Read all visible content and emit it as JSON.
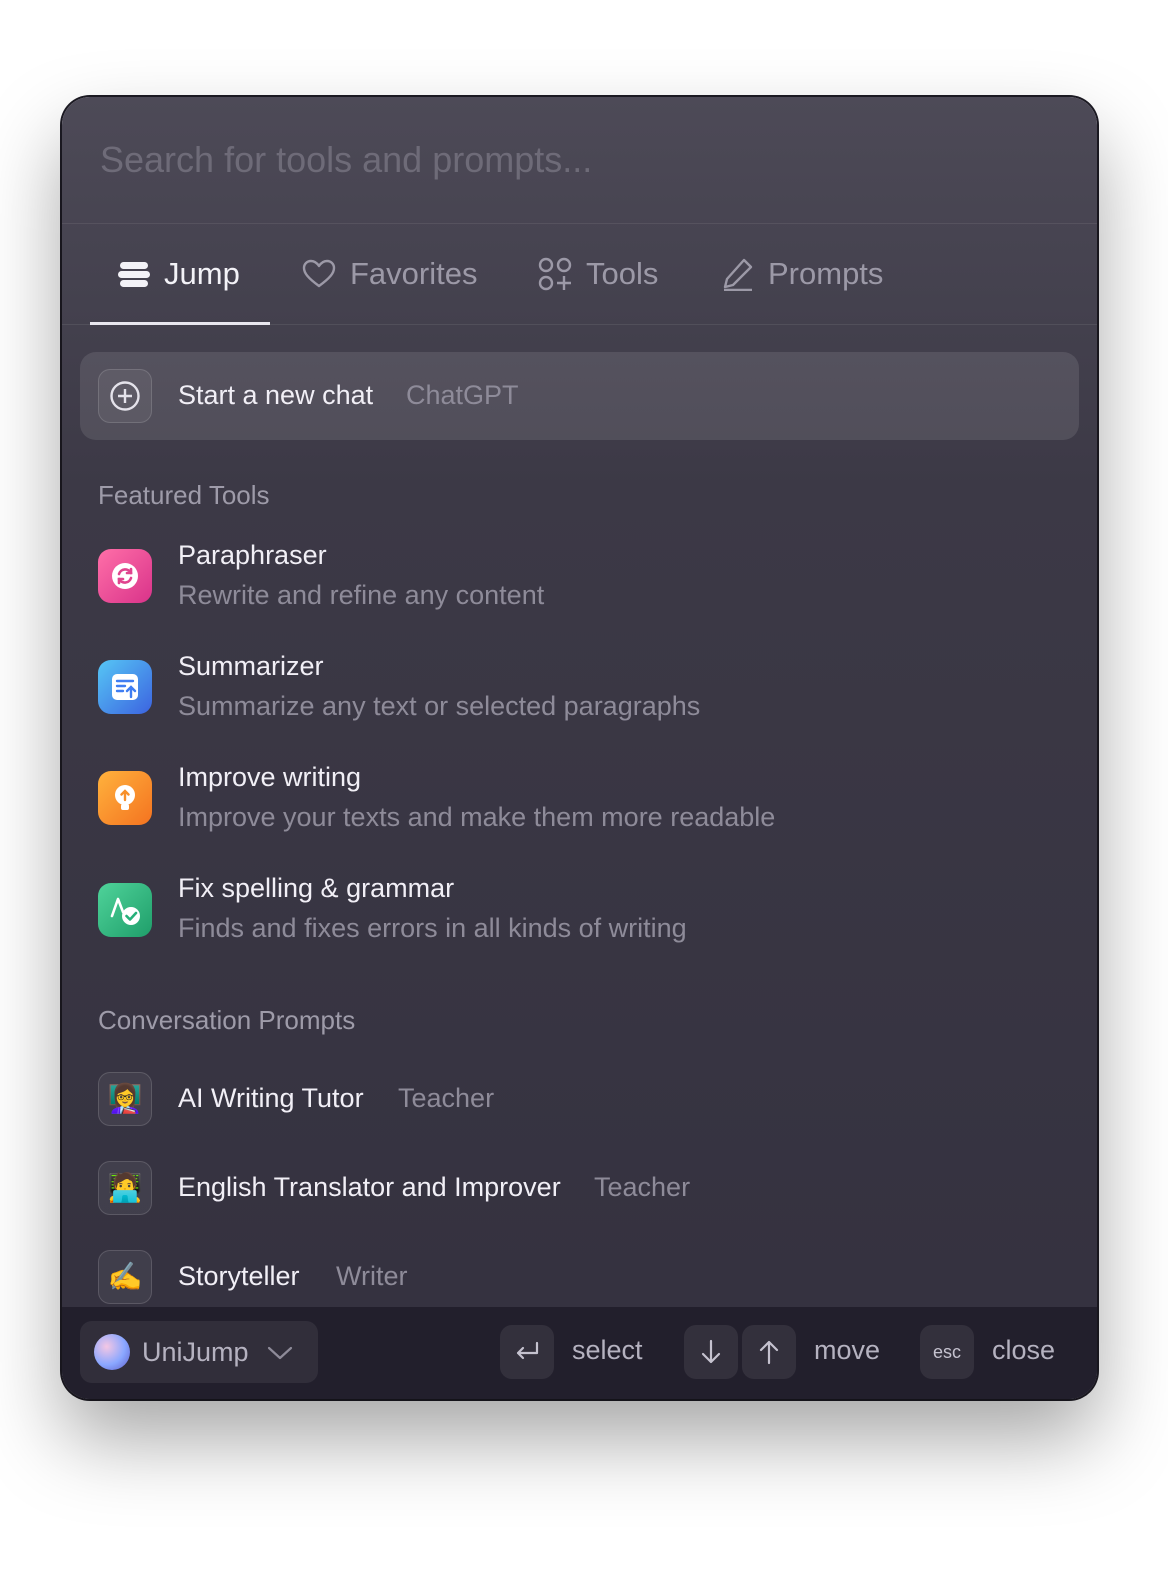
{
  "search": {
    "placeholder": "Search for tools and prompts..."
  },
  "tabs": [
    {
      "label": "Jump",
      "icon": "stack-icon",
      "active": true
    },
    {
      "label": "Favorites",
      "icon": "heart-icon"
    },
    {
      "label": "Tools",
      "icon": "grid-plus-icon"
    },
    {
      "label": "Prompts",
      "icon": "pencil-icon"
    }
  ],
  "new_chat": {
    "title": "Start a new chat",
    "subtitle": "ChatGPT",
    "icon": "plus-circle-icon"
  },
  "featured": {
    "heading": "Featured Tools",
    "items": [
      {
        "title": "Paraphraser",
        "desc": "Rewrite and refine any content",
        "icon": "refresh-icon",
        "color": "#ef4d8f"
      },
      {
        "title": "Summarizer",
        "desc": "Summarize any text or selected paragraphs",
        "icon": "summary-icon",
        "color": "#3f7df2"
      },
      {
        "title": "Improve writing",
        "desc": "Improve your texts and make them more readable",
        "icon": "bulb-icon",
        "color": "#f7902a"
      },
      {
        "title": "Fix spelling & grammar",
        "desc": "Finds and fixes errors in all kinds of writing",
        "icon": "check-text-icon",
        "color": "#27b07a"
      }
    ]
  },
  "conversation": {
    "heading": "Conversation Prompts",
    "items": [
      {
        "title": "AI Writing Tutor",
        "tag": "Teacher",
        "emoji": "👩‍🏫"
      },
      {
        "title": "English Translator and Improver",
        "tag": "Teacher",
        "emoji": "🧑‍💻"
      },
      {
        "title": "Storyteller",
        "tag": "Writer",
        "emoji": "✍️"
      }
    ]
  },
  "footer": {
    "app_name": "UniJump",
    "select_label": "select",
    "move_label": "move",
    "esc_key": "esc",
    "close_label": "close"
  }
}
